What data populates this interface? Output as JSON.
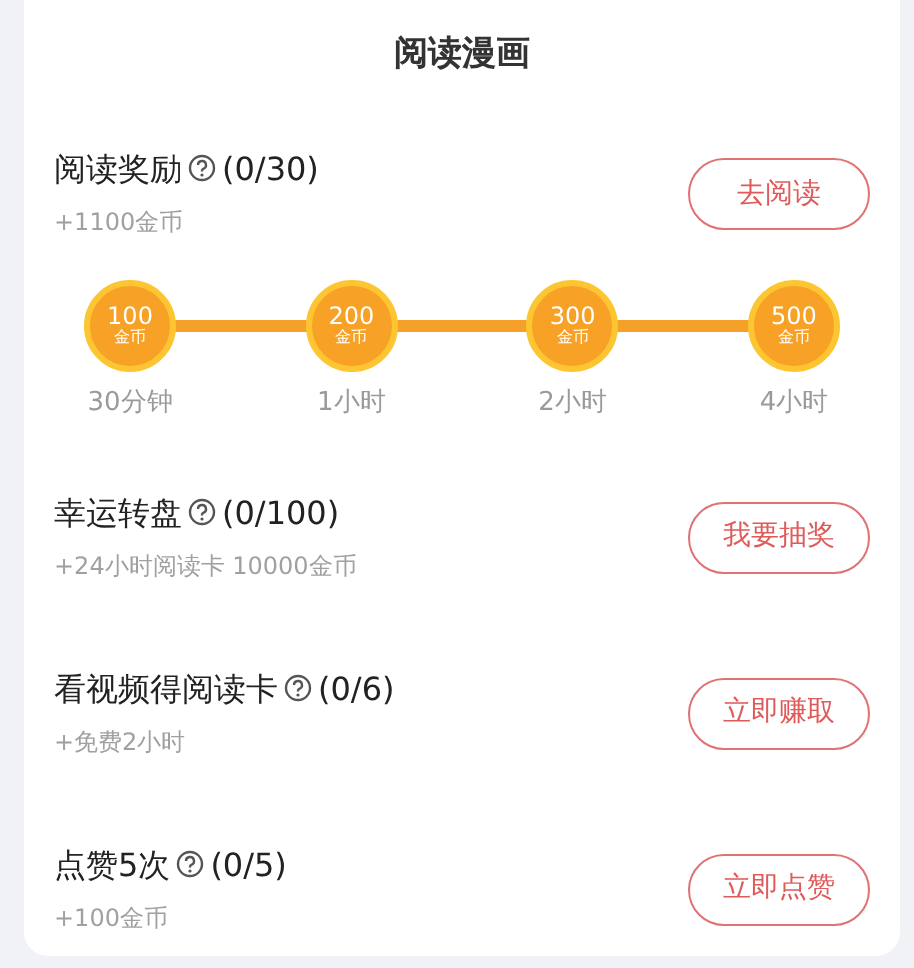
{
  "title": "阅读漫画",
  "tasks": [
    {
      "name": "阅读奖励",
      "progress": "(0/30)",
      "reward": "+1100金币",
      "button": "去阅读",
      "milestones": [
        {
          "coins": "100",
          "unit": "金币",
          "time": "30分钟"
        },
        {
          "coins": "200",
          "unit": "金币",
          "time": "1小时"
        },
        {
          "coins": "300",
          "unit": "金币",
          "time": "2小时"
        },
        {
          "coins": "500",
          "unit": "金币",
          "time": "4小时"
        }
      ]
    },
    {
      "name": "幸运转盘",
      "progress": "(0/100)",
      "reward": "+24小时阅读卡 10000金币",
      "button": "我要抽奖"
    },
    {
      "name": "看视频得阅读卡",
      "progress": "(0/6)",
      "reward": "+免费2小时",
      "button": "立即赚取"
    },
    {
      "name": "点赞5次",
      "progress": "(0/5)",
      "reward": "+100金币",
      "button": "立即点赞"
    }
  ]
}
